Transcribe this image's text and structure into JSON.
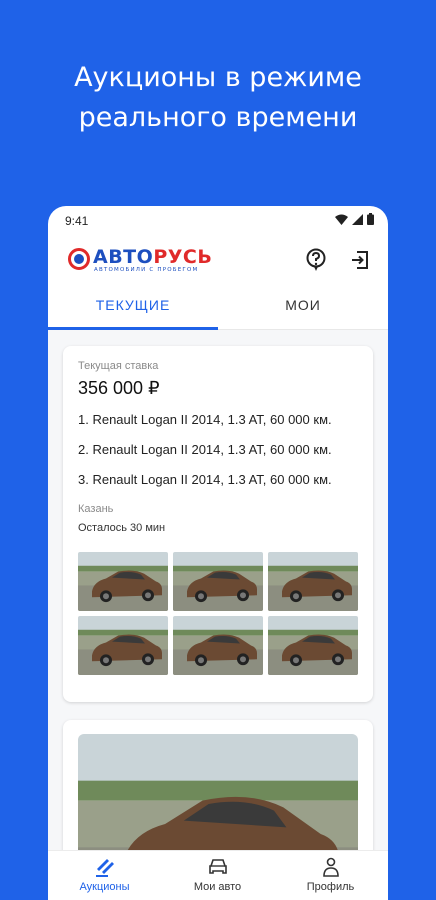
{
  "headline": {
    "line1": "Аукционы в режиме",
    "line2": "реального времени"
  },
  "status_bar": {
    "time": "9:41",
    "icons": [
      "wifi-icon",
      "signal-icon",
      "battery-icon"
    ]
  },
  "logo": {
    "text_part1": "АВТО",
    "text_part2": "РУСЬ",
    "subtitle": "АВТОМОБИЛИ С ПРОБЕГОМ"
  },
  "app_bar": {
    "icons": [
      "help-icon",
      "logout-icon"
    ]
  },
  "tabs": [
    {
      "label": "ТЕКУЩИЕ",
      "active": true
    },
    {
      "label": "МОИ",
      "active": false
    }
  ],
  "auction_card": {
    "bid_label": "Текущая ставка",
    "bid_value": "356 000 ₽",
    "cars": [
      "1. Renault Logan II 2014, 1.3 AT, 60 000 км.",
      "2. Renault Logan II 2014, 1.3 AT, 60 000 км.",
      "3. Renault Logan II 2014, 1.3 AT, 60 000 км."
    ],
    "city": "Казань",
    "remaining": "Осталось 30 мин",
    "photo_count": 6
  },
  "bottom_nav": [
    {
      "label": "Аукционы",
      "icon": "gavel-icon",
      "active": true
    },
    {
      "label": "Мои авто",
      "icon": "car-icon",
      "active": false
    },
    {
      "label": "Профиль",
      "icon": "person-icon",
      "active": false
    }
  ],
  "colors": {
    "brand_blue": "#1f62e8",
    "logo_red": "#e02a2a",
    "logo_blue": "#1d4fbf"
  }
}
